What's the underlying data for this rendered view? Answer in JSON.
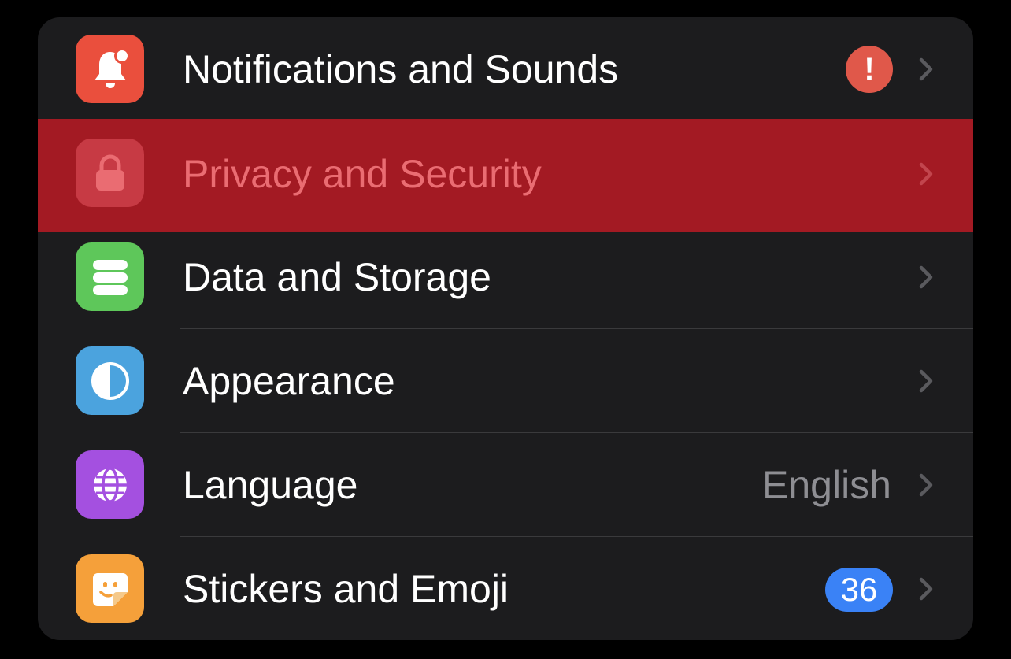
{
  "settings": {
    "rows": [
      {
        "label": "Notifications and Sounds",
        "icon": "bell-icon",
        "icon_color": "#ea4f3d",
        "badge": "!",
        "badge_color": "#e0584a"
      },
      {
        "label": "Privacy and Security",
        "icon": "lock-icon",
        "icon_color": "#c73a44",
        "state": "highlighted",
        "highlight_color": "#a31a23"
      },
      {
        "label": "Data and Storage",
        "icon": "database-icon",
        "icon_color": "#5ec75a"
      },
      {
        "label": "Appearance",
        "icon": "half-circle-icon",
        "icon_color": "#4ba3de"
      },
      {
        "label": "Language",
        "icon": "globe-icon",
        "icon_color": "#a450e0",
        "value": "English"
      },
      {
        "label": "Stickers and Emoji",
        "icon": "sticker-icon",
        "icon_color": "#f5a03a",
        "badge": "36",
        "badge_color": "#3a82f6"
      }
    ]
  }
}
